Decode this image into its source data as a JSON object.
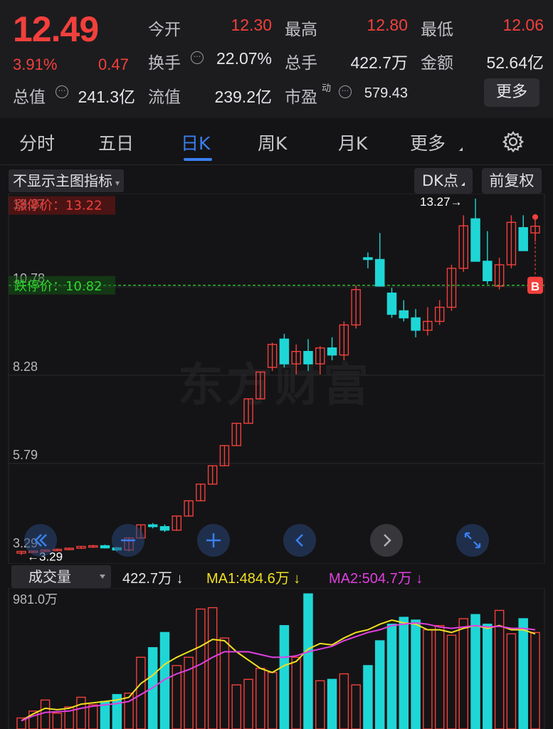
{
  "quote": {
    "price": "12.49",
    "change_pct": "3.91%",
    "change": "0.47",
    "stats": [
      {
        "label": "今开",
        "value": "12.30",
        "color": "#f2403c"
      },
      {
        "label": "最高",
        "value": "12.80",
        "color": "#f2403c"
      },
      {
        "label": "最低",
        "value": "12.06",
        "color": "#f2403c"
      },
      {
        "label": "换手",
        "value": "22.07%",
        "color": "#e6e6ea"
      },
      {
        "label": "总手",
        "value": "422.7万",
        "color": "#e6e6ea"
      },
      {
        "label": "金额",
        "value": "52.64亿",
        "color": "#e6e6ea"
      },
      {
        "label": "总值",
        "value": "241.3亿",
        "color": "#e6e6ea"
      },
      {
        "label": "流值",
        "value": "239.2亿",
        "color": "#e6e6ea"
      },
      {
        "label": "市盈",
        "sup": "动",
        "value": "579.43",
        "color": "#e6e6ea"
      }
    ],
    "more_label": "更多",
    "dots_icon": "···"
  },
  "tabs": [
    "分时",
    "五日",
    "日K",
    "周K",
    "月K",
    "更多"
  ],
  "active_tab": "日K",
  "chart_header": {
    "indicator_label": "不显示主图指标",
    "dk_label": "DK点",
    "fq_label": "前复权"
  },
  "watermark": "东方财富",
  "kline": {
    "y_labels": [
      "13.27",
      "10.78",
      "8.28",
      "5.79",
      "3.29"
    ],
    "limit_up": "涨停价：13.22",
    "limit_down": "跌停价：10.82",
    "max_marker": "13.27",
    "min_marker": "3.29",
    "b_marker": "B",
    "colors": {
      "up": "#f2403c",
      "down": "#1fd6d6",
      "limit_up": "#ff3b30",
      "limit_down": "#2fd62f"
    }
  },
  "volume": {
    "select_label": "成交量",
    "current": "422.7万 ↓",
    "ma1": "MA1:484.6万 ↓",
    "ma2": "MA2:504.7万 ↓",
    "max_label": "981.0万",
    "colors": {
      "ma1": "#f0e020",
      "ma2": "#e040e0"
    }
  },
  "chart_data": {
    "type": "candlestick",
    "ylim": [
      3.29,
      13.27
    ],
    "candles": [
      [
        3.25,
        3.3,
        3.2,
        3.3
      ],
      [
        3.29,
        3.32,
        3.28,
        3.31
      ],
      [
        3.31,
        3.35,
        3.28,
        3.34
      ],
      [
        3.34,
        3.38,
        3.32,
        3.36
      ],
      [
        3.36,
        3.4,
        3.34,
        3.39
      ],
      [
        3.39,
        3.45,
        3.37,
        3.44
      ],
      [
        3.44,
        3.48,
        3.4,
        3.46
      ],
      [
        3.46,
        3.49,
        3.38,
        3.4
      ],
      [
        3.4,
        3.43,
        3.3,
        3.34
      ],
      [
        3.34,
        3.7,
        3.3,
        3.68
      ],
      [
        3.68,
        4.05,
        3.66,
        4.05
      ],
      [
        4.05,
        4.1,
        3.95,
        4.0
      ],
      [
        4.0,
        4.06,
        3.85,
        3.9
      ],
      [
        3.9,
        4.3,
        3.88,
        4.3
      ],
      [
        4.3,
        4.73,
        4.28,
        4.73
      ],
      [
        4.73,
        5.2,
        4.73,
        5.2
      ],
      [
        5.2,
        5.72,
        5.2,
        5.72
      ],
      [
        5.72,
        6.29,
        5.72,
        6.29
      ],
      [
        6.29,
        6.92,
        6.29,
        6.92
      ],
      [
        6.92,
        7.61,
        6.92,
        7.61
      ],
      [
        7.61,
        8.37,
        7.61,
        8.37
      ],
      [
        8.5,
        9.2,
        8.4,
        9.15
      ],
      [
        9.3,
        9.45,
        8.5,
        8.6
      ],
      [
        8.6,
        9.15,
        8.3,
        8.95
      ],
      [
        8.95,
        9.3,
        8.4,
        8.6
      ],
      [
        8.6,
        9.1,
        8.3,
        9.05
      ],
      [
        9.05,
        9.35,
        8.7,
        8.85
      ],
      [
        8.85,
        9.8,
        8.7,
        9.7
      ],
      [
        9.7,
        10.82,
        9.6,
        10.7
      ],
      [
        11.6,
        11.75,
        11.3,
        11.55
      ],
      [
        11.55,
        12.3,
        10.8,
        10.8
      ],
      [
        10.6,
        10.75,
        9.9,
        10.0
      ],
      [
        10.1,
        10.4,
        9.8,
        9.9
      ],
      [
        9.9,
        10.15,
        9.35,
        9.55
      ],
      [
        9.55,
        10.2,
        9.4,
        9.8
      ],
      [
        9.8,
        10.4,
        9.7,
        10.2
      ],
      [
        10.2,
        11.4,
        10.1,
        11.3
      ],
      [
        11.3,
        12.8,
        11.2,
        12.5
      ],
      [
        12.7,
        13.27,
        12.2,
        11.5
      ],
      [
        11.5,
        12.35,
        10.85,
        10.95
      ],
      [
        10.8,
        11.6,
        10.7,
        11.4
      ],
      [
        11.4,
        12.8,
        11.3,
        12.6
      ],
      [
        12.45,
        12.8,
        12.25,
        11.8
      ],
      [
        12.3,
        12.8,
        12.06,
        12.49
      ]
    ],
    "volume": [
      80,
      130,
      210,
      115,
      160,
      230,
      175,
      200,
      250,
      260,
      520,
      590,
      700,
      460,
      520,
      870,
      880,
      660,
      320,
      360,
      440,
      410,
      750,
      520,
      980,
      350,
      360,
      400,
      320,
      460,
      640,
      760,
      810,
      790,
      720,
      750,
      680,
      800,
      830,
      760,
      860,
      690,
      800,
      700
    ],
    "ma1": [
      60,
      110,
      150,
      140,
      150,
      180,
      190,
      200,
      210,
      230,
      330,
      390,
      470,
      520,
      560,
      600,
      650,
      640,
      560,
      500,
      440,
      410,
      460,
      490,
      580,
      620,
      610,
      660,
      700,
      720,
      760,
      790,
      770,
      760,
      720,
      720,
      700,
      730,
      750,
      730,
      750,
      720,
      720,
      690
    ],
    "ma2": [
      60,
      95,
      120,
      125,
      130,
      150,
      165,
      175,
      185,
      200,
      250,
      300,
      360,
      400,
      430,
      470,
      520,
      560,
      560,
      560,
      540,
      520,
      520,
      530,
      560,
      580,
      600,
      640,
      670,
      700,
      720,
      750,
      760,
      770,
      760,
      740,
      730,
      740,
      750,
      740,
      745,
      730,
      730,
      720
    ],
    "vol_ylim": [
      0,
      981
    ]
  }
}
